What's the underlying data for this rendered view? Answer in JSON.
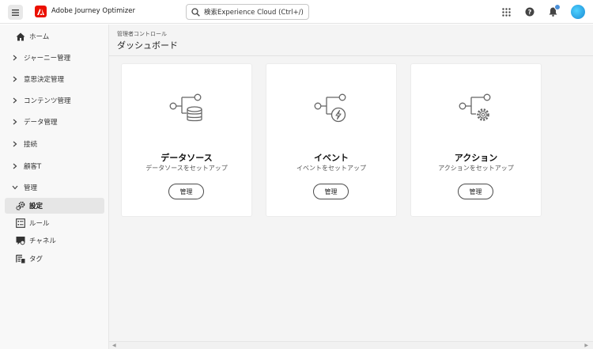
{
  "app": {
    "title": "Adobe Journey Optimizer"
  },
  "search": {
    "label": "検索Experience Cloud (Ctrl+/)"
  },
  "sidebar": {
    "items": [
      {
        "label": "ホーム",
        "icon": "home-icon"
      },
      {
        "label": "ジャーニー管理",
        "icon": "chevron-right-icon"
      },
      {
        "label": "意思決定管理",
        "icon": "chevron-right-icon"
      },
      {
        "label": "コンテンツ管理",
        "icon": "chevron-right-icon"
      },
      {
        "label": "データ管理",
        "icon": "chevron-right-icon"
      },
      {
        "label": "接続",
        "icon": "chevron-right-icon"
      },
      {
        "label": "顧客T",
        "icon": "chevron-right-icon"
      },
      {
        "label": "管理",
        "icon": "chevron-down-icon"
      }
    ],
    "sub_items": [
      {
        "label": "設定",
        "icon": "gears-icon",
        "active": true
      },
      {
        "label": "ルール",
        "icon": "rules-icon"
      },
      {
        "label": "チャネル",
        "icon": "channel-icon"
      },
      {
        "label": "タグ",
        "icon": "tag-list-icon"
      }
    ]
  },
  "main": {
    "breadcrumb": "管理者コントロール",
    "title": "ダッシュボード",
    "cards": [
      {
        "title": "データソース",
        "subtitle": "データソースをセットアップ",
        "button": "管理",
        "icon": "datasource-flow-icon"
      },
      {
        "title": "イベント",
        "subtitle": "イベントをセットアップ",
        "button": "管理",
        "icon": "event-flow-icon"
      },
      {
        "title": "アクション",
        "subtitle": "アクションをセットアップ",
        "button": "管理",
        "icon": "action-flow-icon"
      }
    ]
  },
  "colors": {
    "brand": "#eb1000",
    "notification": "#4a90d9",
    "avatar": "#1a8ad4"
  }
}
